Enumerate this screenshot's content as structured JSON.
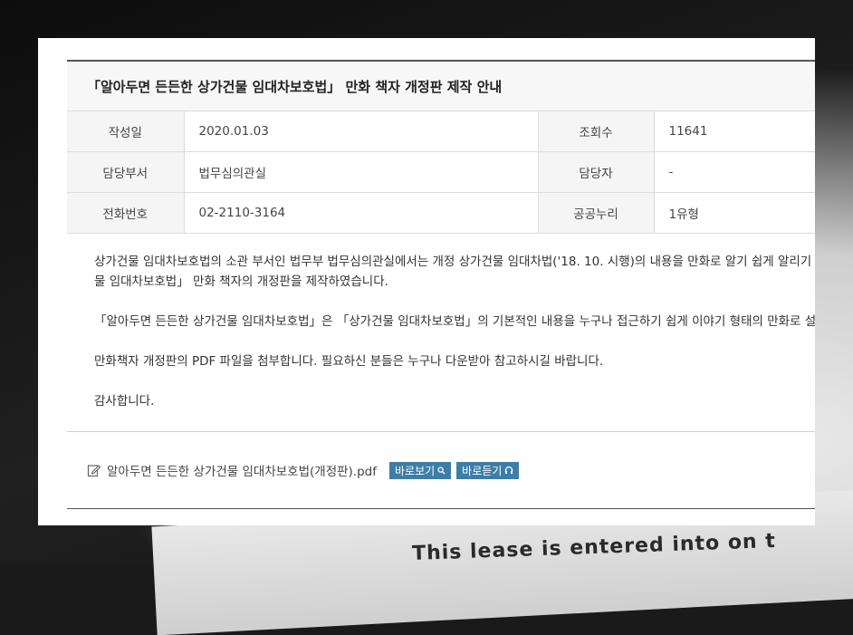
{
  "post": {
    "title": "「알아두면 든든한 상가건물 임대차보호법」 만화 책자 개정판 제작 안내"
  },
  "meta": {
    "rows": [
      {
        "label_left": "작성일",
        "value_left": "2020.01.03",
        "label_right": "조회수",
        "value_right": "11641"
      },
      {
        "label_left": "담당부서",
        "value_left": "법무심의관실",
        "label_right": "담당자",
        "value_right": "-"
      },
      {
        "label_left": "전화번호",
        "value_left": "02-2110-3164",
        "label_right": "공공누리",
        "value_right": "1유형"
      }
    ]
  },
  "body": {
    "p1_line1": "상가건물 임대차보호법의 소관 부서인 법무부 법무심의관실에서는 개정 상가건물 임대차법('18. 10. 시행)의 내용을 만화로 알기 쉽게 알리기",
    "p1_line2": "물 임대차보호법」 만화 책자의 개정판을 제작하였습니다.",
    "p2": "「알아두면 든든한 상가건물 임대차보호법」은 「상가건물 임대차보호법」의 기본적인 내용을 누구나 접근하기 쉽게 이야기 형태의 만화로 설명",
    "p3": "만화책자 개정판의 PDF 파일을 첨부합니다. 필요하신 분들은 누구나 다운받아 참고하시길 바랍니다.",
    "p4": "감사합니다."
  },
  "attachment": {
    "filename": "알아두면 든든한 상가건물 임대차보호법(개정판).pdf",
    "view_label": "바로보기",
    "listen_label": "바로듣기",
    "button_color": "#3d7ea6"
  },
  "background": {
    "paper_text": "This lease is entered into on t"
  }
}
